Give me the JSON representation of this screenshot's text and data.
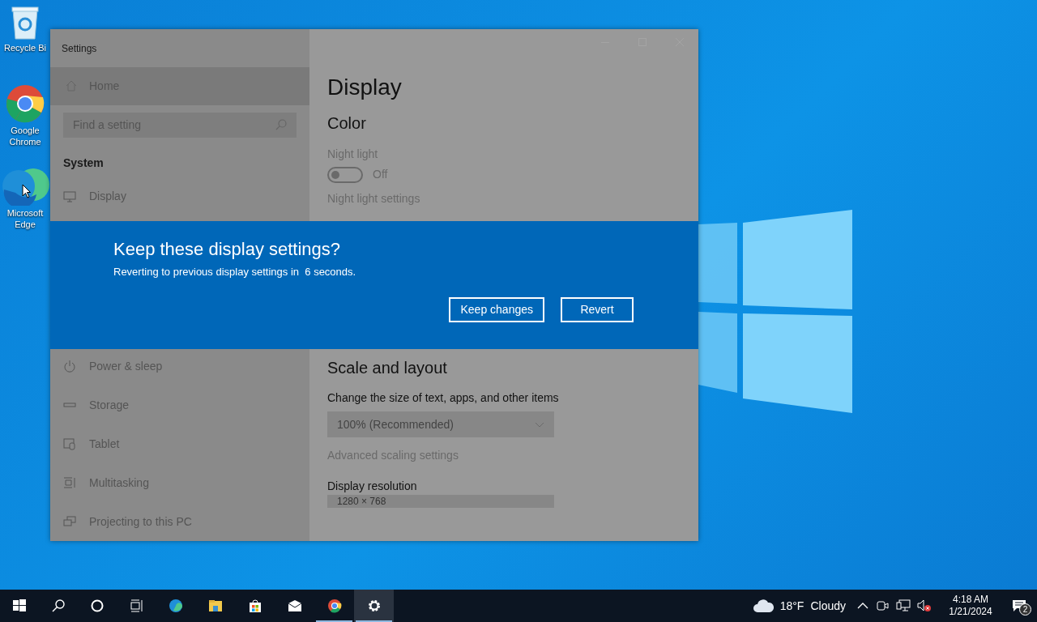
{
  "desktop_icons": [
    {
      "kind": "recycle",
      "label": "Recycle Bi"
    },
    {
      "kind": "chrome",
      "label": "Google Chrome"
    },
    {
      "kind": "edge",
      "label": "Microsoft Edge"
    }
  ],
  "window": {
    "title": "Settings",
    "sidebar": {
      "home": "Home",
      "search": {
        "placeholder": "Find a setting"
      },
      "section": "System",
      "items_top": [
        {
          "kind": "display",
          "label": "Display"
        }
      ],
      "items_bottom": [
        {
          "kind": "power",
          "label": "Power & sleep"
        },
        {
          "kind": "storage",
          "label": "Storage"
        },
        {
          "kind": "tablet",
          "label": "Tablet"
        },
        {
          "kind": "multitasking",
          "label": "Multitasking"
        },
        {
          "kind": "projecting",
          "label": "Projecting to this PC"
        }
      ]
    },
    "content": {
      "title": "Display",
      "color_heading": "Color",
      "night_light": {
        "label": "Night light",
        "on": false,
        "state_text": "Off"
      },
      "night_light_link": "Night light settings",
      "scale_heading": "Scale and layout",
      "scale_label": "Change the size of text, apps, and other items",
      "scale_dropdown": {
        "value": "100% (Recommended)"
      },
      "advanced_link": "Advanced scaling settings",
      "resolution_label": "Display resolution",
      "resolution_dropdown": {
        "value": "1280 × 768"
      }
    }
  },
  "dialog": {
    "title": "Keep these display settings?",
    "message": "Reverting to previous display settings in  6 seconds.",
    "buttons": [
      "Keep changes",
      "Revert"
    ]
  },
  "taskbar": {
    "buttons": [
      {
        "kind": "start"
      },
      {
        "kind": "search"
      },
      {
        "kind": "cortana"
      },
      {
        "kind": "taskview"
      }
    ],
    "apps": [
      {
        "kind": "edge",
        "running": false,
        "selected": false
      },
      {
        "kind": "explorer",
        "running": false,
        "selected": false
      },
      {
        "kind": "store",
        "running": false,
        "selected": false
      },
      {
        "kind": "mail",
        "running": false,
        "selected": false
      },
      {
        "kind": "chrome",
        "running": true,
        "selected": false
      },
      {
        "kind": "settings",
        "running": true,
        "selected": true
      }
    ],
    "weather": {
      "temperature": "18°F",
      "condition": "Cloudy"
    },
    "clock": {
      "time": "4:18 AM",
      "date": "1/21/2024"
    },
    "notifications": {
      "count": "2"
    }
  }
}
